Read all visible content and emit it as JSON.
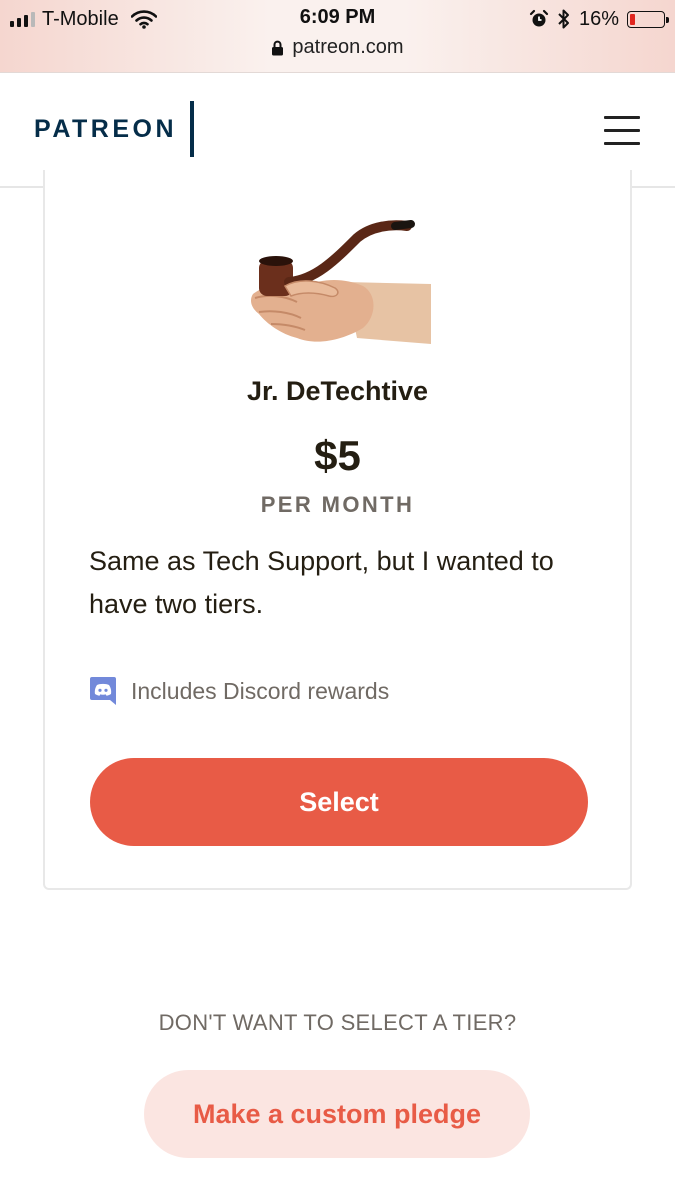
{
  "status_bar": {
    "carrier": "T-Mobile",
    "time": "6:09 PM",
    "battery_percent": "16%",
    "battery_level": 0.16,
    "url": "patreon.com",
    "icons": [
      "signal-icon",
      "wifi-icon",
      "alarm-icon",
      "bluetooth-icon",
      "battery-icon",
      "lock-icon"
    ]
  },
  "header": {
    "logo": "PATREON",
    "menu_icon": "hamburger-menu-icon"
  },
  "tier": {
    "image": "hand-holding-pipe-image",
    "name": "Jr. DeTechtive",
    "price": "$5",
    "period": "PER MONTH",
    "description": "Same as Tech Support, but I wanted to have two tiers.",
    "benefit_icon": "discord-icon",
    "benefit": "Includes Discord rewards",
    "select_label": "Select"
  },
  "footer": {
    "no_tier_text": "DON'T WANT TO SELECT A TIER?",
    "custom_pledge_label": "Make a custom pledge"
  },
  "colors": {
    "brand_navy": "#052d49",
    "accent_coral": "#e85b46",
    "accent_light": "#fbe5e1",
    "discord_blurple": "#7289da",
    "text_dark": "#241e12",
    "text_muted": "#706a64"
  }
}
